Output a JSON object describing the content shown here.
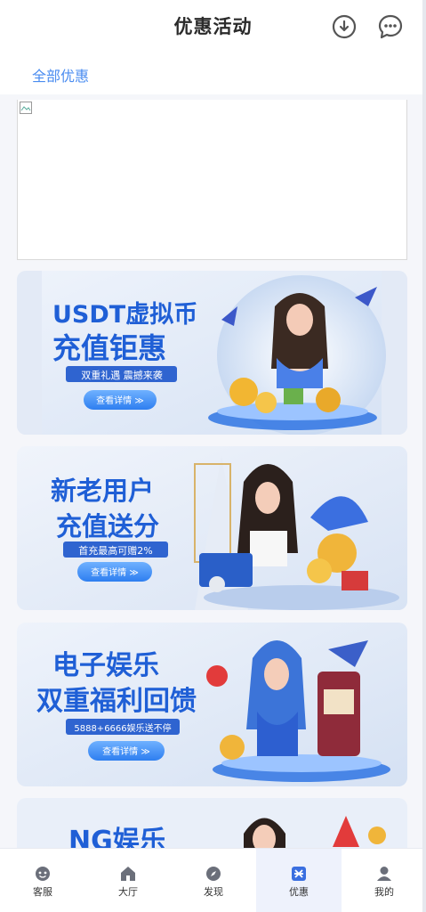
{
  "header": {
    "title": "优惠活动",
    "download_icon": "download-circle-icon",
    "chat_icon": "chat-bubble-icon"
  },
  "tabs": {
    "all_label": "全部优惠"
  },
  "promos": [
    {
      "title_line1": "USDT虚拟币",
      "title_line2": "充值钜惠",
      "ribbon": "双重礼遇 震撼来袭",
      "button": "查看详情 ≫"
    },
    {
      "title_line1": "新老用户",
      "title_line2": "充值送分",
      "ribbon": "首充最高可赠2%",
      "button": "查看详情 ≫"
    },
    {
      "title_line1": "电子娱乐",
      "title_line2": "双重福利回馈",
      "ribbon": "5888+6666娱乐送不停",
      "button": "查看详情 ≫"
    },
    {
      "title_line1": "NG娱乐"
    }
  ],
  "nav": [
    {
      "label": "客服",
      "icon": "customer-service-icon",
      "active": false
    },
    {
      "label": "大厅",
      "icon": "home-icon",
      "active": false
    },
    {
      "label": "发现",
      "icon": "discover-icon",
      "active": false
    },
    {
      "label": "优惠",
      "icon": "gift-icon",
      "active": true
    },
    {
      "label": "我的",
      "icon": "user-icon",
      "active": false
    }
  ],
  "colors": {
    "accent": "#4a8cf0",
    "title_blue": "#1f5fd6",
    "nav_active_bg": "#eef2fc",
    "icon_gray": "#555555"
  }
}
